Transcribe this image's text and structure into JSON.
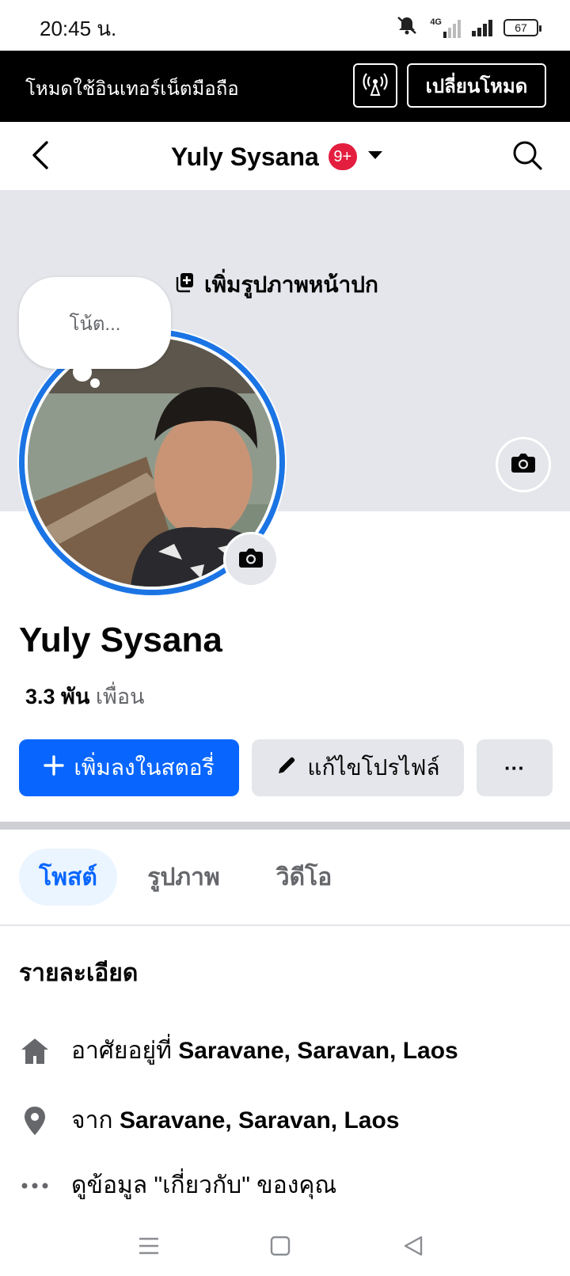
{
  "status_bar": {
    "time": "20:45 น.",
    "network": "4G",
    "battery": "67"
  },
  "data_mode": {
    "message": "โหมดใช้อินเทอร์เน็ตมือถือ",
    "switch_label": "เปลี่ยนโหมด"
  },
  "nav": {
    "title": "Yuly Sysana",
    "badge": "9+"
  },
  "cover": {
    "add_cover_label": "เพิ่มรูปภาพหน้าปก"
  },
  "note": {
    "placeholder": "โน้ต..."
  },
  "profile": {
    "name": "Yuly Sysana",
    "friends_count": "3.3 พัน",
    "friends_label": "เพื่อน"
  },
  "actions": {
    "add_story": "เพิ่มลงในสตอรี่",
    "edit_profile": "แก้ไขโปรไฟล์",
    "more": "···"
  },
  "tabs": [
    {
      "label": "โพสต์",
      "active": true
    },
    {
      "label": "รูปภาพ",
      "active": false
    },
    {
      "label": "วิดีโอ",
      "active": false
    }
  ],
  "details": {
    "title": "รายละเอียด",
    "lives_prefix": "อาศัยอยู่ที่",
    "lives_value": "Saravane, Saravan, Laos",
    "from_prefix": "จาก",
    "from_value": "Saravane, Saravan, Laos",
    "about_link": "ดูข้อมูล \"เกี่ยวกับ\" ของคุณ"
  },
  "colors": {
    "primary": "#0866ff",
    "ring": "#1b74e4",
    "badge": "#e41e3f",
    "cover": "#e4e6eb",
    "secondary_text": "#65676b"
  }
}
